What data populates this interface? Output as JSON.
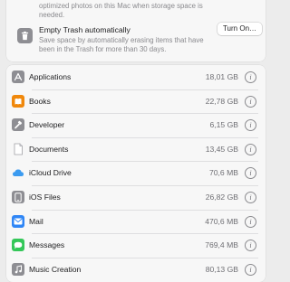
{
  "storage_options": {
    "optimize_desc_partial": "optimized photos on this Mac when storage space is needed.",
    "empty_trash": {
      "title": "Empty Trash automatically",
      "description": "Save space by automatically erasing items that have been in the Trash for more than 30 days.",
      "button_label": "Turn On…",
      "icon": "trash-icon"
    }
  },
  "categories": [
    {
      "label": "Applications",
      "size": "18,01 GB",
      "icon": "applications-icon",
      "color": "#8e8e93"
    },
    {
      "label": "Books",
      "size": "22,78 GB",
      "icon": "books-icon",
      "color": "#f0880c"
    },
    {
      "label": "Developer",
      "size": "6,15 GB",
      "icon": "developer-icon",
      "color": "#8e8e93"
    },
    {
      "label": "Documents",
      "size": "13,45 GB",
      "icon": "documents-icon",
      "color": "#c7c7cc"
    },
    {
      "label": "iCloud Drive",
      "size": "70,6 MB",
      "icon": "icloud-icon",
      "color": "#3b9bf0"
    },
    {
      "label": "iOS Files",
      "size": "26,82 GB",
      "icon": "ios-files-icon",
      "color": "#8e8e93"
    },
    {
      "label": "Mail",
      "size": "470,6 MB",
      "icon": "mail-icon",
      "color": "#2f86f6"
    },
    {
      "label": "Messages",
      "size": "769,4 MB",
      "icon": "messages-icon",
      "color": "#34c759"
    },
    {
      "label": "Music Creation",
      "size": "80,13 GB",
      "icon": "music-creation-icon",
      "color": "#8e8e93"
    }
  ]
}
